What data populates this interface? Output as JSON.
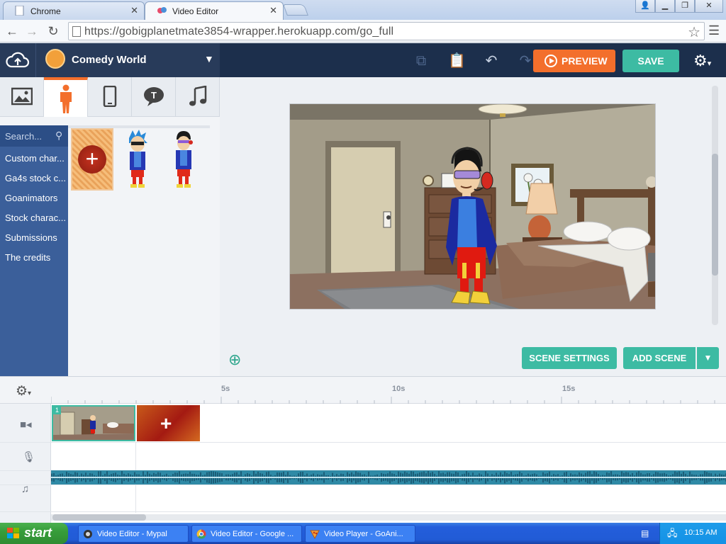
{
  "browser": {
    "tabs": [
      {
        "label": "Chrome",
        "active": false
      },
      {
        "label": "Video Editor",
        "active": true
      }
    ],
    "url": "https://gobigplanetmate3854-wrapper.herokuapp.com/go_full"
  },
  "header": {
    "theme_title": "Comedy World",
    "preview_label": "PREVIEW",
    "save_label": "SAVE"
  },
  "left_panel": {
    "categories": [
      "image",
      "character",
      "prop",
      "text",
      "sound"
    ],
    "active_category": "character",
    "search_placeholder": "Search...",
    "items": [
      {
        "label": "Custom char..."
      },
      {
        "label": "Ga4s stock c..."
      },
      {
        "label": "Goanimators"
      },
      {
        "label": "Stock charac..."
      },
      {
        "label": "Submissions"
      },
      {
        "label": "The credits"
      }
    ]
  },
  "stage": {
    "scene_settings_label": "SCENE SETTINGS",
    "add_scene_label": "ADD SCENE"
  },
  "timeline": {
    "ticks": [
      "5s",
      "10s",
      "15s"
    ],
    "scene_number": "1"
  },
  "taskbar": {
    "start_label": "start",
    "tasks": [
      {
        "label": "Video Editor - Mypal"
      },
      {
        "label": "Video Editor - Google ..."
      },
      {
        "label": "Video Player - GoAni..."
      }
    ],
    "clock": "10:15 AM"
  },
  "colors": {
    "accent_teal": "#3dbba3",
    "preview_orange": "#f36f2c",
    "header_navy": "#1c2f4c",
    "sidebar_blue": "#3b5f9a"
  }
}
